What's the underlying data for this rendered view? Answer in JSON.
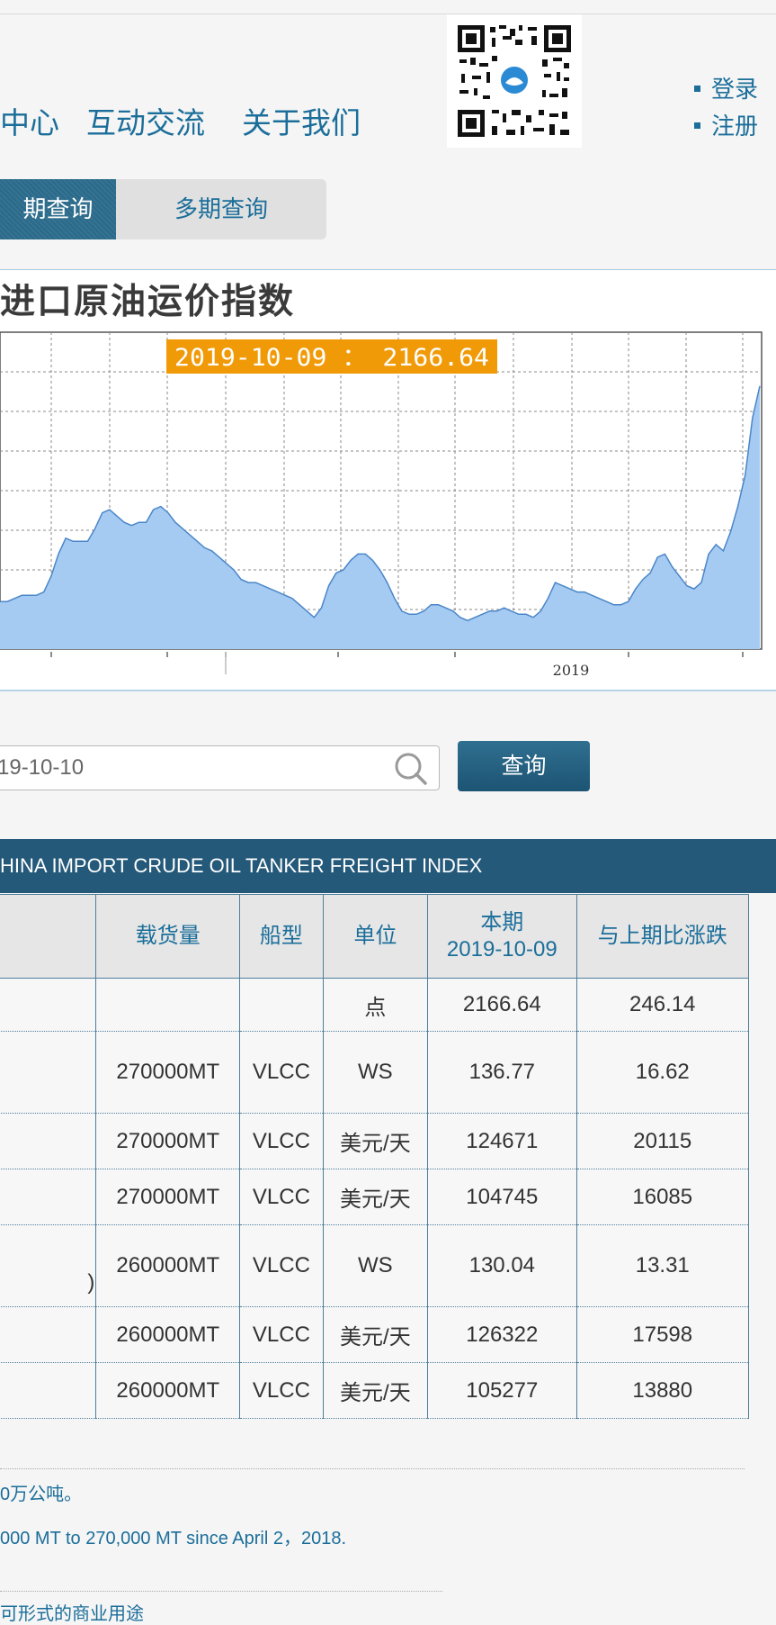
{
  "nav": {
    "items": [
      "中心",
      "互动交流",
      "关于我们"
    ]
  },
  "auth": {
    "login": "登录",
    "register": "注册"
  },
  "tabs": {
    "single": "期查询",
    "multi": "多期查询"
  },
  "chart_panel": {
    "title": "进口原油运价指数"
  },
  "chart_data": {
    "type": "area",
    "tooltip": "2019-10-09 ： 2166.64",
    "x_tick_label": "2019",
    "color": "#a6cbf2",
    "line_color": "#4a86c8",
    "y_relative": [
      0.15,
      0.15,
      0.16,
      0.17,
      0.17,
      0.17,
      0.18,
      0.23,
      0.3,
      0.35,
      0.34,
      0.34,
      0.34,
      0.38,
      0.43,
      0.44,
      0.42,
      0.4,
      0.39,
      0.4,
      0.4,
      0.44,
      0.45,
      0.43,
      0.4,
      0.38,
      0.36,
      0.34,
      0.32,
      0.31,
      0.29,
      0.27,
      0.25,
      0.22,
      0.21,
      0.21,
      0.2,
      0.19,
      0.18,
      0.17,
      0.16,
      0.14,
      0.12,
      0.1,
      0.13,
      0.2,
      0.24,
      0.25,
      0.28,
      0.3,
      0.3,
      0.28,
      0.25,
      0.21,
      0.16,
      0.12,
      0.11,
      0.11,
      0.12,
      0.14,
      0.14,
      0.13,
      0.12,
      0.1,
      0.09,
      0.1,
      0.11,
      0.12,
      0.12,
      0.13,
      0.12,
      0.11,
      0.11,
      0.1,
      0.12,
      0.16,
      0.21,
      0.2,
      0.19,
      0.18,
      0.18,
      0.17,
      0.16,
      0.15,
      0.14,
      0.14,
      0.15,
      0.19,
      0.22,
      0.24,
      0.29,
      0.3,
      0.26,
      0.23,
      0.2,
      0.19,
      0.21,
      0.3,
      0.33,
      0.31,
      0.37,
      0.45,
      0.55,
      0.73,
      0.83
    ]
  },
  "search": {
    "date_value": "19-10-10",
    "button": "查询"
  },
  "table": {
    "title": "HINA IMPORT CRUDE OIL TANKER FREIGHT INDEX",
    "headers": {
      "cargo": "载货量",
      "ship": "船型",
      "unit": "单位",
      "current_line1": "本期",
      "current_line2": "2019-10-09",
      "change": "与上期比涨跌"
    },
    "rows": [
      {
        "cargo": "",
        "ship": "",
        "unit": "点",
        "current": "2166.64",
        "change": "246.14"
      },
      {
        "cargo": "270000MT",
        "ship": "VLCC",
        "unit": "WS",
        "current": "136.77",
        "change": "16.62"
      },
      {
        "cargo": "270000MT",
        "ship": "VLCC",
        "unit": "美元/天",
        "current": "124671",
        "change": "20115"
      },
      {
        "cargo": "270000MT",
        "ship": "VLCC",
        "unit": "美元/天",
        "current": "104745",
        "change": "16085"
      },
      {
        "cargo": "260000MT",
        "ship": "VLCC",
        "unit": "WS",
        "current": "130.04",
        "change": "13.31"
      },
      {
        "cargo": "260000MT",
        "ship": "VLCC",
        "unit": "美元/天",
        "current": "126322",
        "change": "17598"
      },
      {
        "cargo": "260000MT",
        "ship": "VLCC",
        "unit": "美元/天",
        "current": "105277",
        "change": "13880"
      }
    ],
    "row5_fragment": ")"
  },
  "notes": {
    "line1": "0万公吨。",
    "line2": "000 MT to 270,000 MT since April 2，2018.",
    "line3": "可形式的商业用途"
  }
}
